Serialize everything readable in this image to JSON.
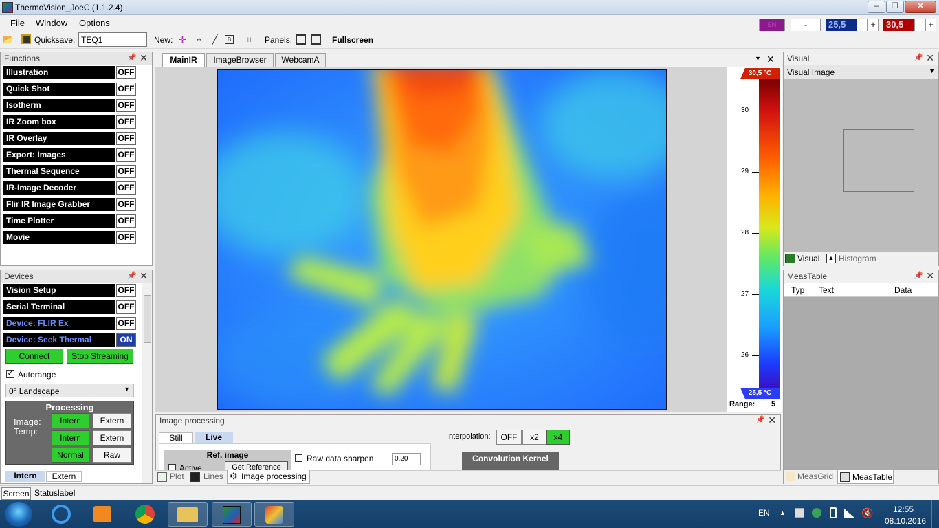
{
  "window": {
    "title": "ThermoVision_JoeC (1.1.2.4)"
  },
  "menu": [
    "File",
    "Window",
    "Options"
  ],
  "topbar": {
    "lang": "EN",
    "dash": "-",
    "temp_low": "25,5",
    "temp_high": "30,5",
    "minus": "-",
    "plus": "+"
  },
  "toolbar": {
    "quicksave_label": "Quicksave:",
    "quicksave_value": "TEQ1",
    "new_label": "New:",
    "panels_label": "Panels:",
    "fullscreen": "Fullscreen"
  },
  "functions": {
    "title": "Functions",
    "items": [
      {
        "label": "Illustration",
        "state": "OFF"
      },
      {
        "label": "Quick Shot",
        "state": "OFF"
      },
      {
        "label": "Isotherm",
        "state": "OFF"
      },
      {
        "label": "IR Zoom box",
        "state": "OFF"
      },
      {
        "label": "IR Overlay",
        "state": "OFF"
      },
      {
        "label": "Export: Images",
        "state": "OFF"
      },
      {
        "label": "Thermal Sequence",
        "state": "OFF"
      },
      {
        "label": "IR-Image Decoder",
        "state": "OFF"
      },
      {
        "label": "Flir IR Image Grabber",
        "state": "OFF"
      },
      {
        "label": "Time Plotter",
        "state": "OFF"
      },
      {
        "label": "Movie",
        "state": "OFF"
      }
    ]
  },
  "devices": {
    "title": "Devices",
    "items": [
      {
        "label": "Vision Setup",
        "state": "OFF"
      },
      {
        "label": "Serial Terminal",
        "state": "OFF"
      },
      {
        "label": "Device: FLIR Ex",
        "state": "OFF"
      },
      {
        "label": "Device: Seek Thermal",
        "state": "ON"
      }
    ],
    "connect": "Connect",
    "stop": "Stop Streaming",
    "autorange": "Autorange",
    "orientation": "0° Landscape",
    "processing_title": "Processing",
    "image_label": "Image:",
    "temp_label": "Temp:",
    "intern": "Intern",
    "extern": "Extern",
    "normal": "Normal",
    "raw": "Raw",
    "tab_intern": "Intern",
    "tab_extern": "Extern"
  },
  "main_tabs": [
    "MainIR",
    "ImageBrowser",
    "WebcamA"
  ],
  "scale": {
    "max_label": "30,5 °C",
    "min_label": "25,5 °C",
    "ticks": [
      "30",
      "29",
      "28",
      "27",
      "26"
    ],
    "range_label": "Range:",
    "range_value": "5"
  },
  "visual": {
    "title": "Visual",
    "select": "Visual Image",
    "tab_visual": "Visual",
    "tab_histogram": "Histogram"
  },
  "meastable": {
    "title": "MeasTable",
    "cols": [
      "Typ",
      "Text",
      "Data"
    ],
    "tab_grid": "MeasGrid",
    "tab_table": "MeasTable"
  },
  "image_processing": {
    "title": "Image processing",
    "tab_still": "Still",
    "tab_live": "Live",
    "ref_image": "Ref. image",
    "active": "Active",
    "get_reference": "Get Reference",
    "raw_sharpen": "Raw data sharpen",
    "sharpen_value": "0,20",
    "interpolation_label": "Interpolation:",
    "interp": [
      "OFF",
      "x2",
      "x4"
    ],
    "kernel": "Convolution Kernel"
  },
  "bottom_tabs": {
    "plot": "Plot",
    "lines": "Lines",
    "improc": "Image processing"
  },
  "status": {
    "screen": "Screen",
    "label": "Statuslabel"
  },
  "taskbar": {
    "lang": "EN",
    "time": "12:55",
    "date": "08.10.2016"
  },
  "colors": {
    "on": "#2dce2d",
    "accent_blue": "#6b8cff",
    "temp_low_bg": "#0a2a8c",
    "temp_high_bg": "#b00000"
  }
}
